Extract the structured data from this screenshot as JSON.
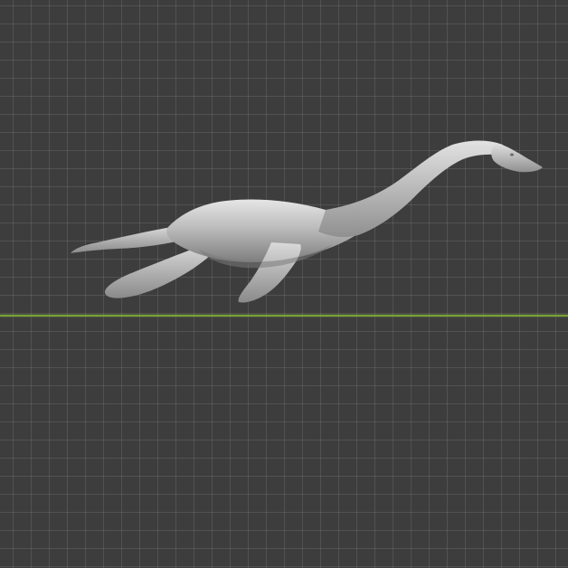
{
  "viewport": {
    "background_color": "#3d3d3d",
    "grid_color": "#4b4b4b",
    "x_axis_color": "#7aa23a",
    "model": {
      "name": "plesiosaur-model",
      "shade_light": "#d9d9d9",
      "shade_mid": "#b8b8b8",
      "shade_dark": "#8f8f8f"
    }
  }
}
